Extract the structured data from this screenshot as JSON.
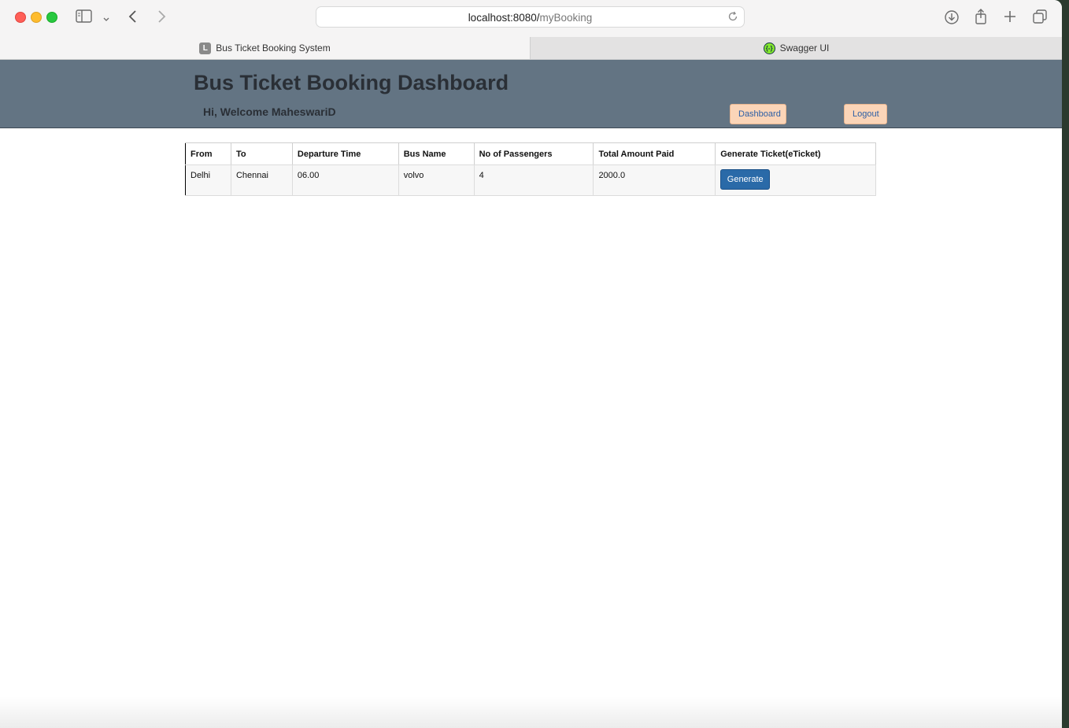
{
  "browser": {
    "url_host": "localhost:8080/",
    "url_path": "myBooking",
    "tabs": [
      {
        "label": "Bus Ticket Booking System",
        "favicon": "L"
      },
      {
        "label": "Swagger UI",
        "favicon": "{-}"
      }
    ]
  },
  "header": {
    "title": "Bus Ticket Booking Dashboard",
    "welcome": "Hi, Welcome MaheswariD",
    "dashboard_label": "Dashboard",
    "logout_label": "Logout"
  },
  "table": {
    "columns": [
      "From",
      "To",
      "Departure Time",
      "Bus Name",
      "No of Passengers",
      "Total Amount Paid",
      "Generate Ticket(eTicket)"
    ],
    "rows": [
      {
        "from": "Delhi",
        "to": "Chennai",
        "departure": "06.00",
        "bus_name": "volvo",
        "passengers": "4",
        "amount": "2000.0",
        "action_label": "Generate"
      }
    ]
  },
  "colors": {
    "header_bg": "#637483",
    "nav_button_bg": "#fbd5b8",
    "generate_button_bg": "#2a6aa8"
  }
}
